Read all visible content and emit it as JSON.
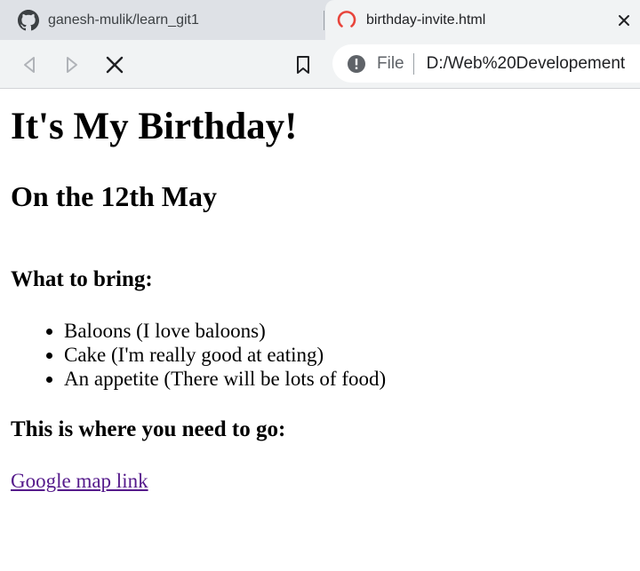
{
  "browser": {
    "tabs": [
      {
        "title": "ganesh-mulik/learn_git1",
        "icon": "github-icon",
        "active": false
      },
      {
        "title": "birthday-invite.html",
        "icon": "loading-spinner-icon",
        "active": true
      }
    ],
    "address_bar": {
      "scheme_label": "File",
      "url": "D:/Web%20Developement"
    },
    "colors": {
      "tab_strip": "#dee1e6",
      "toolbar": "#f1f3f4",
      "spinner": "#e8453c",
      "visited_link": "#551a8b"
    }
  },
  "page": {
    "heading": "It's My Birthday!",
    "date_heading": "On the 12th May",
    "bring_heading": "What to bring:",
    "bring_items": [
      "Baloons (I love baloons)",
      "Cake (I'm really good at eating)",
      "An appetite (There will be lots of food)"
    ],
    "directions_heading": "This is where you need to go:",
    "map_link_text": "Google map link"
  }
}
